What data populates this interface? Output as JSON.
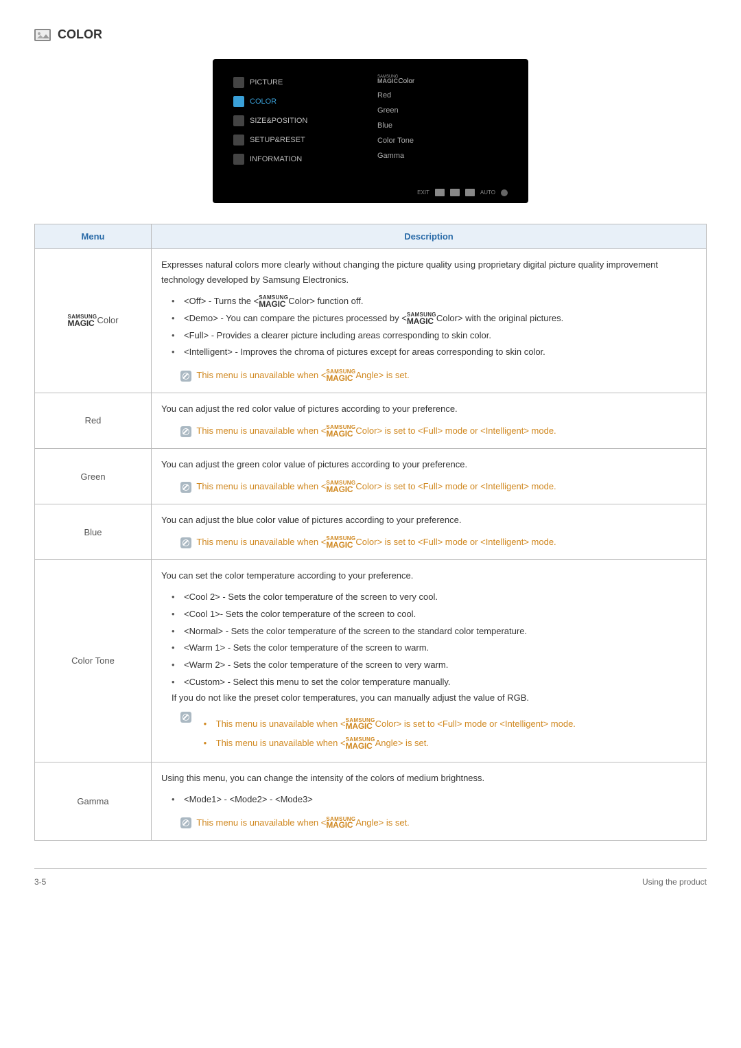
{
  "section": {
    "title": "COLOR"
  },
  "osd": {
    "left": {
      "picture": "PICTURE",
      "color": "COLOR",
      "sizepos": "SIZE&POSITION",
      "setup": "SETUP&RESET",
      "info": "INFORMATION"
    },
    "right": {
      "magicColor": "Color",
      "red": "Red",
      "green": "Green",
      "blue": "Blue",
      "colorTone": "Color Tone",
      "gamma": "Gamma"
    },
    "footer": {
      "exit": "EXIT",
      "auto": "AUTO"
    }
  },
  "table": {
    "header": {
      "menu": "Menu",
      "description": "Description"
    },
    "rows": {
      "magicColor": {
        "menu": "Color",
        "intro": "Expresses natural colors more clearly without changing the picture quality using proprietary digital picture quality improvement technology developed by Samsung Electronics.",
        "off": "<Off> - Turns the <",
        "offEnd": "Color> function off.",
        "demo": "<Demo> - You can compare the pictures processed by <",
        "demoEnd": "Color> with the original pictures.",
        "full": "<Full> - Provides a clearer picture including areas corresponding to skin color.",
        "intelligent": "<Intelligent> - Improves the chroma of pictures except for areas corresponding to skin color.",
        "note": "This menu is unavailable when <",
        "noteEnd": "Angle> is set."
      },
      "red": {
        "menu": "Red",
        "intro": "You can adjust the red color value of pictures according to your preference.",
        "note": "This menu is unavailable when <",
        "noteEnd": "Color> is set to <Full> mode or <Intelligent> mode."
      },
      "green": {
        "menu": "Green",
        "intro": "You can adjust the green color value of pictures according to your preference.",
        "note": "This menu is unavailable when <",
        "noteEnd": "Color> is set to <Full> mode or <Intelligent> mode."
      },
      "blue": {
        "menu": "Blue",
        "intro": "You can adjust the blue color value of pictures according to your preference.",
        "note": "This menu is unavailable when <",
        "noteEnd": "Color> is set to <Full> mode or <Intelligent> mode."
      },
      "colorTone": {
        "menu": "Color Tone",
        "intro": "You can set the color temperature according to your preference.",
        "cool2": "<Cool 2> - Sets the color temperature of the screen to very cool.",
        "cool1": "<Cool 1>- Sets the color temperature of the screen to cool.",
        "normal": "<Normal> - Sets the color temperature of the screen to the standard color temperature.",
        "warm1": "<Warm 1> - Sets the color temperature of the screen to warm.",
        "warm2": "<Warm 2> - Sets the color temperature of the screen to very warm.",
        "custom": "<Custom> - Select this menu to set the color temperature manually.",
        "customNote": "If you do not like the preset color temperatures, you can manually adjust the value of RGB.",
        "note1": "This menu is unavailable when <",
        "note1End": "Color> is set to <Full> mode or <Intelligent> mode.",
        "note2": "This menu is unavailable when <",
        "note2End": "Angle> is set."
      },
      "gamma": {
        "menu": "Gamma",
        "intro": "Using this menu, you can change the intensity of the colors of medium brightness.",
        "modes": "<Mode1> - <Mode2> - <Mode3>",
        "note": "This menu is unavailable when <",
        "noteEnd": "Angle> is set."
      }
    }
  },
  "footer": {
    "left": "3-5",
    "right": "Using the product"
  },
  "magic": {
    "samsung": "SAMSUNG",
    "magic": "MAGIC"
  }
}
